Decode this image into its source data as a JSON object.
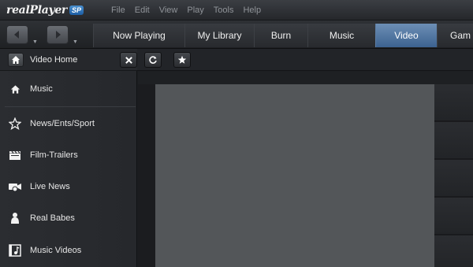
{
  "app": {
    "logo_text": "realPlayer",
    "logo_badge": "SP"
  },
  "menu": [
    "File",
    "Edit",
    "View",
    "Play",
    "Tools",
    "Help"
  ],
  "tabs": [
    {
      "label": "Now Playing"
    },
    {
      "label": "My Library"
    },
    {
      "label": "Burn"
    },
    {
      "label": "Music"
    },
    {
      "label": "Video",
      "active": true
    },
    {
      "label": "Gam"
    }
  ],
  "sidebar": {
    "home_label": "Video Home",
    "items": [
      {
        "label": "Music",
        "icon": "home-icon"
      },
      {
        "label": "News/Ents/Sport",
        "icon": "star-icon"
      },
      {
        "label": "Film-Trailers",
        "icon": "clapperboard-icon"
      },
      {
        "label": "Live News",
        "icon": "camera-icon"
      },
      {
        "label": "Real Babes",
        "icon": "person-icon"
      },
      {
        "label": "Music Videos",
        "icon": "music-video-icon"
      }
    ]
  },
  "toolbar": {
    "buttons": [
      "close-icon",
      "refresh-icon",
      "star-icon"
    ]
  },
  "colors": {
    "accent_tab": "#4d74a3",
    "background": "#1c1e21",
    "video_panel": "#535659"
  }
}
